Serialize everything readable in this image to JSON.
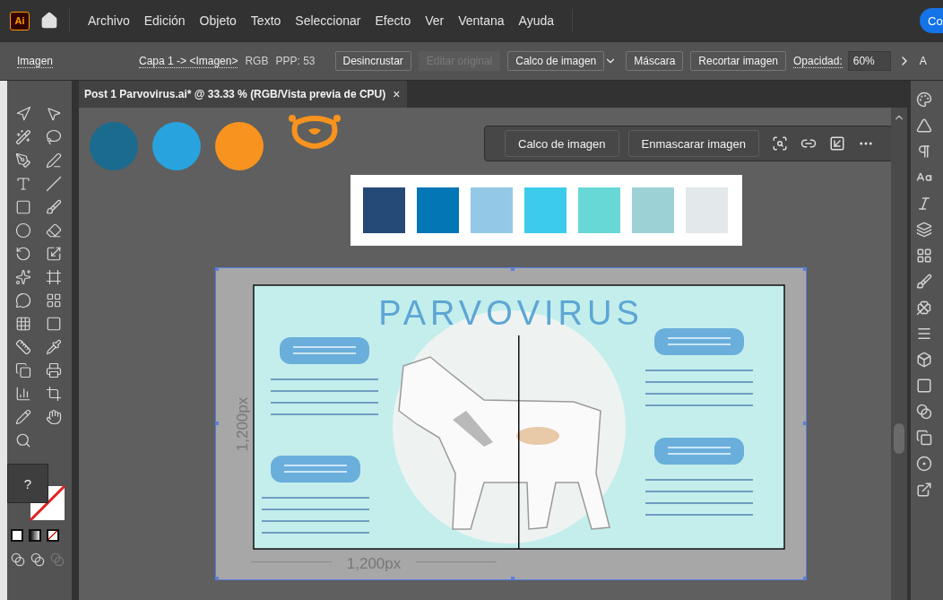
{
  "app": {
    "logo": "Ai",
    "share_button": "Co"
  },
  "menu": [
    "Archivo",
    "Edición",
    "Objeto",
    "Texto",
    "Seleccionar",
    "Efecto",
    "Ver",
    "Ventana",
    "Ayuda"
  ],
  "control_bar": {
    "object_type": "Imagen",
    "layer_path": "Capa 1 -> <Imagen>",
    "color_mode": "RGB",
    "ppi": "PPP: 53",
    "buttons": [
      {
        "label": "Desincrustar",
        "kind": "button",
        "disabled": false
      },
      {
        "label": "Editar original",
        "kind": "button",
        "disabled": true
      },
      {
        "label": "Calco de imagen",
        "kind": "split",
        "disabled": false
      },
      {
        "label": "Máscara",
        "kind": "button",
        "disabled": false
      },
      {
        "label": "Recortar imagen",
        "kind": "button",
        "disabled": false
      }
    ],
    "opacity_label": "Opacidad:",
    "opacity_value": "60%",
    "overflow_label": "A"
  },
  "document_tab": {
    "title": "Post 1 Parvovirus.ai* @ 33.33 % (RGB/Vista previa de CPU)",
    "close": "×"
  },
  "tools_panel": {
    "help": "?"
  },
  "canvas": {
    "circles": [
      {
        "color": "#1b6b8f"
      },
      {
        "color": "#28a3dd"
      },
      {
        "color": "#f7931e"
      }
    ],
    "context_toolbar": [
      "Calco de imagen",
      "Enmascarar imagen"
    ],
    "swatches": [
      {
        "color": "#264a78"
      },
      {
        "color": "#0376b5"
      },
      {
        "color": "#93c9e6"
      },
      {
        "color": "#3ccbeb"
      },
      {
        "color": "#68d8d6"
      },
      {
        "color": "#9cd2d6"
      },
      {
        "color": "#e3e8ea"
      }
    ],
    "artwork": {
      "title": "PARVOVIRUS",
      "height_label": "1,200px",
      "width_label": "1,200px"
    }
  }
}
